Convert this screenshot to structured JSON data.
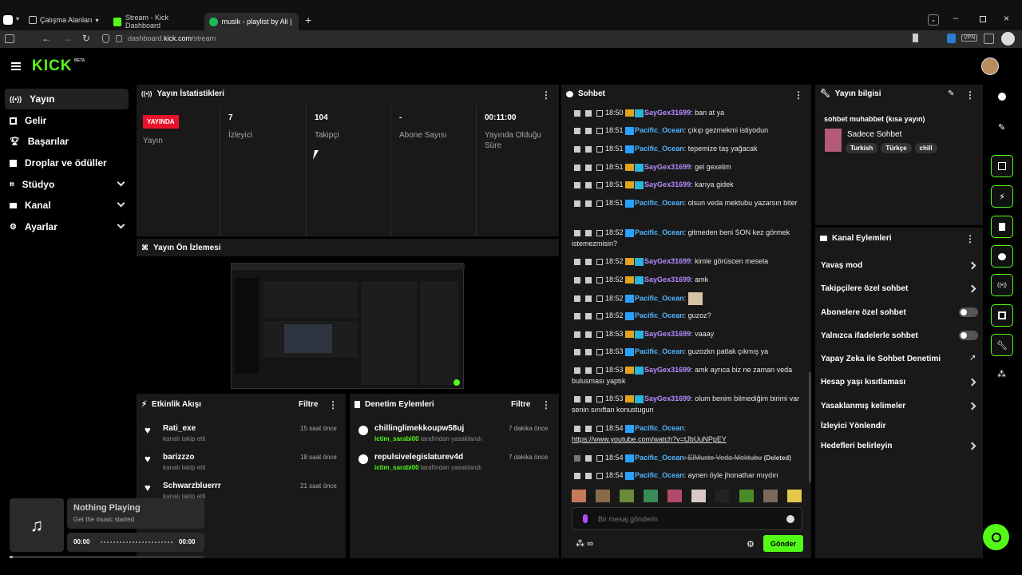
{
  "browser": {
    "workspaces_label": "Çalışma Alanları",
    "tabs": [
      {
        "label": "Stream - Kick Dashboard"
      },
      {
        "label": "musik - playlist by Ali | Spo"
      }
    ],
    "url_host": "dashboard.",
    "url_domain": "kick.com",
    "url_path": "/stream",
    "vpn_label": "VPN"
  },
  "kick": {
    "logo": "KICK",
    "logo_badge": "BETA"
  },
  "sidebar": {
    "items": [
      {
        "label": "Yayın"
      },
      {
        "label": "Gelir"
      },
      {
        "label": "Başarılar"
      },
      {
        "label": "Droplar ve ödüller"
      },
      {
        "label": "Stüdyo"
      },
      {
        "label": "Kanal"
      },
      {
        "label": "Ayarlar"
      }
    ]
  },
  "stats": {
    "title": "Yayın İstatistikleri",
    "live_badge": "YAYINDA",
    "live_label": "Yayın",
    "viewers_value": "7",
    "viewers_label": "İzleyici",
    "followers_value": "104",
    "followers_label": "Takipçi",
    "subs_value": "-",
    "subs_label": "Abone Sayısı",
    "uptime_value": "00:11:00",
    "uptime_label": "Yayında Olduğu Süre"
  },
  "preview": {
    "title": "Yayın Ön İzlemesi"
  },
  "activity": {
    "title": "Etkinlik Akışı",
    "filter": "Filtre",
    "items": [
      {
        "name": "Rati_exe",
        "sub": "kanalı takip etti",
        "time": "15 saat önce"
      },
      {
        "name": "barizzzo",
        "sub": "kanalı takip etti",
        "time": "18 saat önce"
      },
      {
        "name": "Schwarzbluerrr",
        "sub": "kanalı takip etti",
        "time": "21 saat önce"
      }
    ]
  },
  "moderation": {
    "title": "Denetim Eylemleri",
    "filter": "Filtre",
    "items": [
      {
        "name": "chillinglimekkoupw58uj",
        "by": "ictim_sarabi00",
        "sub": "tarafından yasaklandı",
        "time": "7 dakika önce"
      },
      {
        "name": "repulsivelegislaturev4d",
        "by": "ictim_sarabi00",
        "sub": "tarafından yasaklandı",
        "time": "7 dakika önce"
      }
    ]
  },
  "chat": {
    "title": "Sohbet",
    "placeholder": "Bir mesaj gönderin",
    "send": "Gönder",
    "messages": [
      {
        "time": "18:50",
        "user": "SayGex31699",
        "text": ": ban at ya"
      },
      {
        "time": "18:51",
        "user": "Pacific_Ocean",
        "text": ": çıkıp gezmekmi istiyodun"
      },
      {
        "time": "18:51",
        "user": "Pacific_Ocean",
        "text": ": tepemize taş yağacak"
      },
      {
        "time": "18:51",
        "user": "SayGex31699",
        "text": ": gel gexelim"
      },
      {
        "time": "18:51",
        "user": "SayGex31699",
        "text": ": karıya gidek"
      },
      {
        "time": "18:51",
        "user": "Pacific_Ocean",
        "text": ": olsun veda mektubu yazarsın biter"
      },
      {
        "time": "18:52",
        "user": "Pacific_Ocean",
        "text": ": gitmeden beni SON kez görmek istemezmisin?"
      },
      {
        "time": "18:52",
        "user": "SayGex31699",
        "text": ": kimle görüscen mesela"
      },
      {
        "time": "18:52",
        "user": "SayGex31699",
        "text": ": amk"
      },
      {
        "time": "18:52",
        "user": "Pacific_Ocean",
        "text": ":"
      },
      {
        "time": "18:52",
        "user": "Pacific_Ocean",
        "text": ": guzoz?"
      },
      {
        "time": "18:53",
        "user": "SayGex31699",
        "text": ": vaaay"
      },
      {
        "time": "18:53",
        "user": "Pacific_Ocean",
        "text": ": guzozkn patlak çıkmış ya"
      },
      {
        "time": "18:53",
        "user": "SayGex31699",
        "text": ": amk ayrıca biz ne zaman veda bulusması yaptık"
      },
      {
        "time": "18:53",
        "user": "SayGex31699",
        "text": ": olum benim bilmediğim birimi var senin sınıftan konustugun"
      },
      {
        "time": "18:54",
        "user": "Pacific_Ocean",
        "text": ":"
      },
      {
        "time": "18:54",
        "user": "Pacific_Ocean",
        "text": ": ElMusto Veda Mektubu",
        "deleted": "(Deleted)"
      },
      {
        "time": "18:54",
        "user": "Pacific_Ocean",
        "text": ": aynen öyle jhonathar mıydın"
      }
    ],
    "link": "https://www.youtube.com/watch?v=tJbUuNPpEY"
  },
  "stream_info": {
    "title": "Yayın bilgisi",
    "stream_title": "sohbet muhabbet (kısa yayın)",
    "category": "Sadece Sohbet",
    "tags": [
      "Turkish",
      "Türkçe",
      "chill"
    ]
  },
  "channel_actions": {
    "title": "Kanal Eylemleri",
    "items": [
      {
        "label": "Yavaş mod"
      },
      {
        "label": "Takipçilere özel sohbet"
      },
      {
        "label": "Abonelere özel sohbet"
      },
      {
        "label": "Yalnızca ifadelerle sohbet"
      },
      {
        "label": "Yapay Zeka ile Sohbet Denetimi"
      },
      {
        "label": "Hesap yaşı kısıtlaması"
      },
      {
        "label": "Yasaklanmış kelimeler"
      },
      {
        "label": "İzleyici Yönlendir"
      },
      {
        "label": "Hedefleri belirleyin"
      }
    ]
  },
  "player": {
    "title": "Nothing Playing",
    "sub": "Get the music started",
    "start": "00:00",
    "end": "00:00"
  }
}
